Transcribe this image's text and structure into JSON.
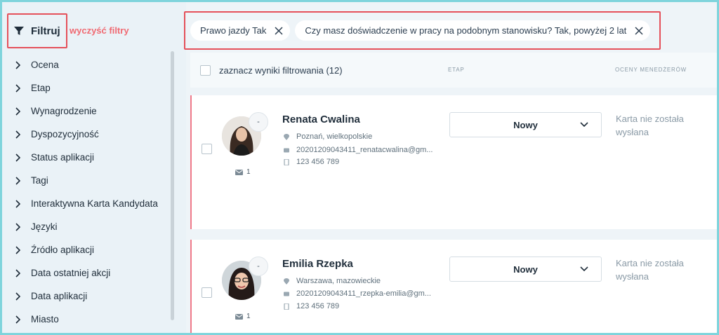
{
  "sidebar": {
    "filter_label": "Filtruj",
    "clear_label": "wyczyść filtry",
    "items": [
      {
        "label": "Ocena"
      },
      {
        "label": "Etap"
      },
      {
        "label": "Wynagrodzenie"
      },
      {
        "label": "Dyspozycyjność"
      },
      {
        "label": "Status aplikacji"
      },
      {
        "label": "Tagi"
      },
      {
        "label": "Interaktywna Karta Kandydata"
      },
      {
        "label": "Języki"
      },
      {
        "label": "Źródło aplikacji"
      },
      {
        "label": "Data ostatniej akcji"
      },
      {
        "label": "Data aplikacji"
      },
      {
        "label": "Miasto"
      }
    ]
  },
  "active_filters": [
    {
      "label": "Prawo jazdy Tak"
    },
    {
      "label": "Czy masz doświadczenie w pracy na podobnym stanowisku? Tak, powyżej 2 lat"
    }
  ],
  "results": {
    "select_label": "zaznacz wyniki filtrowania (12)",
    "col_stage": "ETAP",
    "col_ratings": "OCENY MENEDŻERÓW"
  },
  "candidates": [
    {
      "name": "Renata Cwalina",
      "location": "Poznań, wielkopolskie",
      "email": "20201209043411_renatacwalina@gm...",
      "phone": "123 456 789",
      "badge": "-",
      "messages": "1",
      "stage": "Nowy",
      "rating_text": "Karta nie została wysłana"
    },
    {
      "name": "Emilia Rzepka",
      "location": "Warszawa, mazowieckie",
      "email": "20201209043411_rzepka-emilia@gm...",
      "phone": "123 456 789",
      "badge": "-",
      "messages": "1",
      "stage": "Nowy",
      "rating_text": "Karta nie została wysłana"
    }
  ],
  "colors": {
    "accent_red": "#e5505a",
    "clear_link": "#f06a72",
    "card_border": "#f07a8a",
    "outer_border": "#7fd4dc"
  }
}
